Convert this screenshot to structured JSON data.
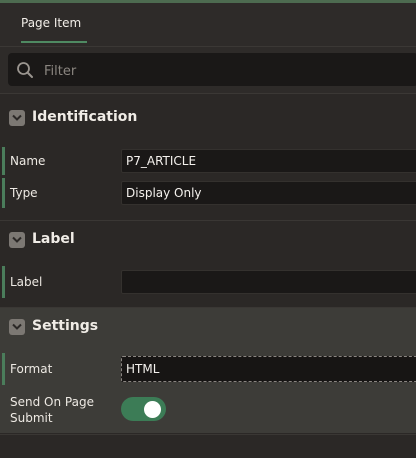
{
  "tabs": [
    {
      "label": "Page Item",
      "active": true
    }
  ],
  "filter": {
    "placeholder": "Filter",
    "value": ""
  },
  "groups": {
    "identification": {
      "title": "Identification",
      "name": {
        "label": "Name",
        "value": "P7_ARTICLE"
      },
      "type": {
        "label": "Type",
        "value": "Display Only"
      }
    },
    "label": {
      "title": "Label",
      "label": {
        "label": "Label",
        "value": ""
      }
    },
    "settings": {
      "title": "Settings",
      "format": {
        "label": "Format",
        "value": "HTML"
      },
      "send_on_page_submit": {
        "label_line1": "Send On Page",
        "label_line2": "Submit",
        "value": true
      }
    }
  },
  "icons": {
    "search": "search-icon",
    "collapse": "chevron-down-icon"
  },
  "colors": {
    "accent": "#4f8a62",
    "toggle_on": "#3c7c56",
    "panel_bg": "#2b2826",
    "settings_bg": "#3d3c38",
    "input_bg": "#1a1817"
  }
}
